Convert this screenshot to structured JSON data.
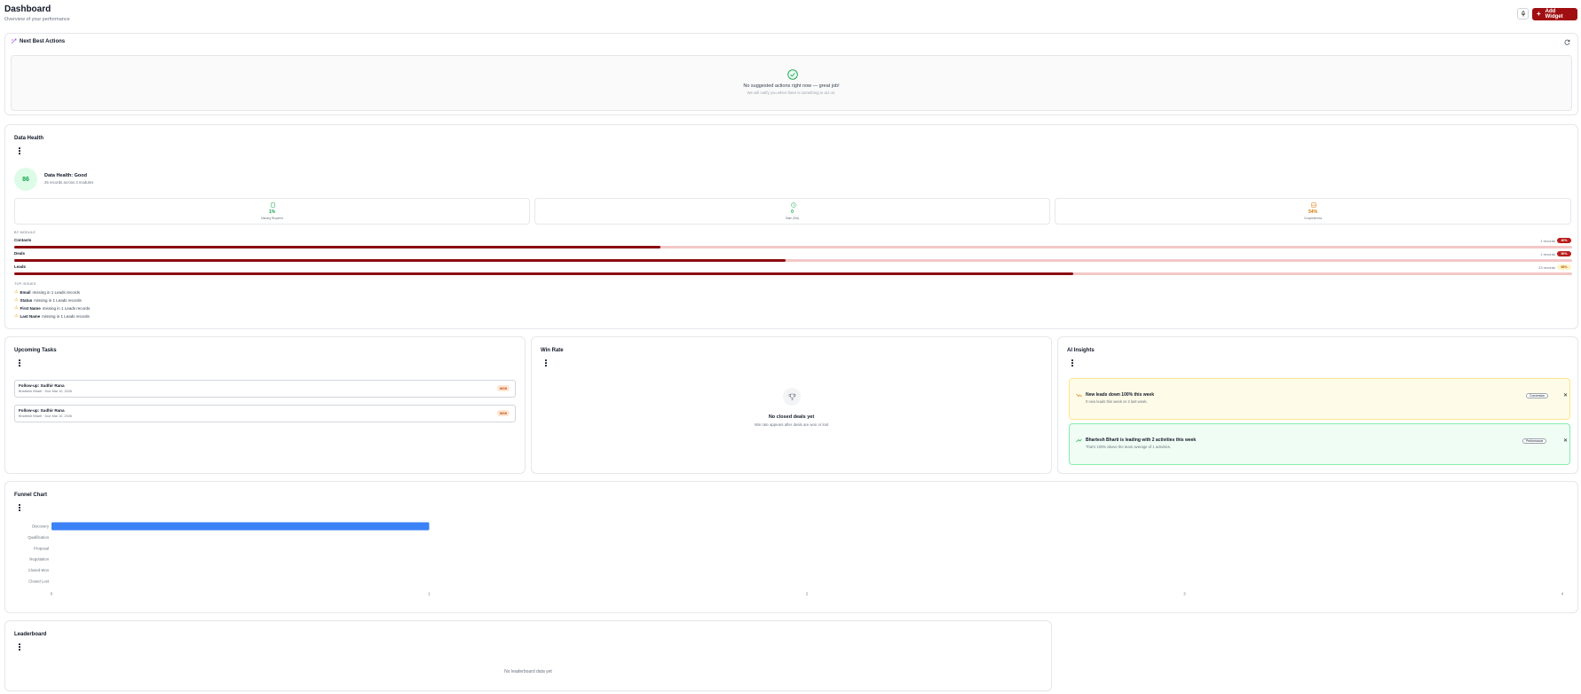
{
  "header": {
    "title": "Dashboard",
    "subtitle": "Overview of your performance",
    "add_widget_label": "Add Widget"
  },
  "nba": {
    "title": "Next Best Actions",
    "empty_title": "No suggested actions right now — great job!",
    "empty_sub": "We will notify you when there is something to act on."
  },
  "data_health": {
    "title": "Data Health",
    "score": "86",
    "status": "Data Health: Good",
    "records_summary": "25 records across 3 modules",
    "stats": [
      {
        "value": "1%",
        "label": "Missing Required",
        "color": "#16a34a"
      },
      {
        "value": "0",
        "label": "Stale (90d)",
        "color": "#16a34a"
      },
      {
        "value": "54%",
        "label": "Completeness",
        "color": "#d97706"
      }
    ],
    "by_module_label": "BY MODULE",
    "modules": [
      {
        "name": "Contacts",
        "count": "1 records",
        "pct": "40%",
        "fill": 0.41
      },
      {
        "name": "Deals",
        "count": "1 records",
        "pct": "50%",
        "fill": 0.5
      },
      {
        "name": "Leads",
        "count": "23 records",
        "pct": "68%",
        "fill": 0.68
      }
    ],
    "top_issues_label": "TOP ISSUES",
    "issues": [
      {
        "field": "Email",
        "text": "missing in 1 Leads records"
      },
      {
        "field": "Status",
        "text": "missing in 1 Leads records"
      },
      {
        "field": "First Name",
        "text": "missing in 1 Leads records"
      },
      {
        "field": "Last Name",
        "text": "missing in 1 Leads records"
      }
    ]
  },
  "tasks": {
    "title": "Upcoming Tasks",
    "items": [
      {
        "title": "Follow-up: Sudhir Rana",
        "sub": "Bhartesh Bharti · Due Mar 10, 2026",
        "priority": "HIGH"
      },
      {
        "title": "Follow-up: Sudhir Rana",
        "sub": "Bhartesh Bharti · Due Mar 10, 2026",
        "priority": "HIGH"
      }
    ]
  },
  "win_rate": {
    "title": "Win Rate",
    "empty_title": "No closed deals yet",
    "empty_sub": "Win rate appears after deals are won or lost"
  },
  "ai_insights": {
    "title": "AI Insights",
    "items": [
      {
        "title": "New leads down 100% this week",
        "sub": "0 new leads this week vs 2 last week.",
        "tag": "Conversion",
        "bg": "#fefce8",
        "border": "#fde68a"
      },
      {
        "title": "Bhartesh Bharti is leading with 2 activities this week",
        "sub": "That's 100% above the team average of 1 activities.",
        "tag": "Performance",
        "bg": "#f0fdf4",
        "border": "#86efac"
      }
    ]
  },
  "funnel": {
    "title": "Funnel Chart"
  },
  "chart_data": {
    "type": "bar",
    "orientation": "horizontal",
    "categories": [
      "Discovery",
      "Qualification",
      "Proposal",
      "Negotiation",
      "Closed Won",
      "Closed Lost"
    ],
    "values": [
      1,
      0,
      0,
      0,
      0,
      0
    ],
    "xlim": [
      0,
      4
    ],
    "xticks": [
      "0",
      "1",
      "2",
      "3",
      "4"
    ],
    "color": "#3b82f6"
  },
  "leaderboard": {
    "title": "Leaderboard",
    "empty": "No leaderboard data yet"
  }
}
